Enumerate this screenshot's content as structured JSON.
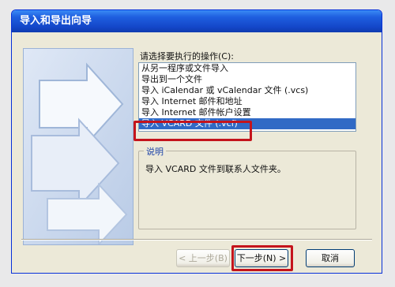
{
  "window": {
    "title": "导入和导出向导"
  },
  "prompt_label": "请选择要执行的操作(C):",
  "actions": [
    "从另一程序或文件导入",
    "导出到一个文件",
    "导入 iCalendar 或 vCalendar 文件 (.vcs)",
    "导入 Internet 邮件和地址",
    "导入 Internet 邮件帐户设置",
    "导入 VCARD 文件 (.vcf)"
  ],
  "selected_index": 5,
  "description": {
    "legend": "说明",
    "text": "导入 VCARD 文件到联系人文件夹。"
  },
  "buttons": {
    "back": "< 上一步(B)",
    "next": "下一步(N) >",
    "cancel": "取消"
  },
  "colors": {
    "title_bar": "#1f5fe0",
    "selection": "#316ac5",
    "highlight_annotation": "#c4141c"
  }
}
